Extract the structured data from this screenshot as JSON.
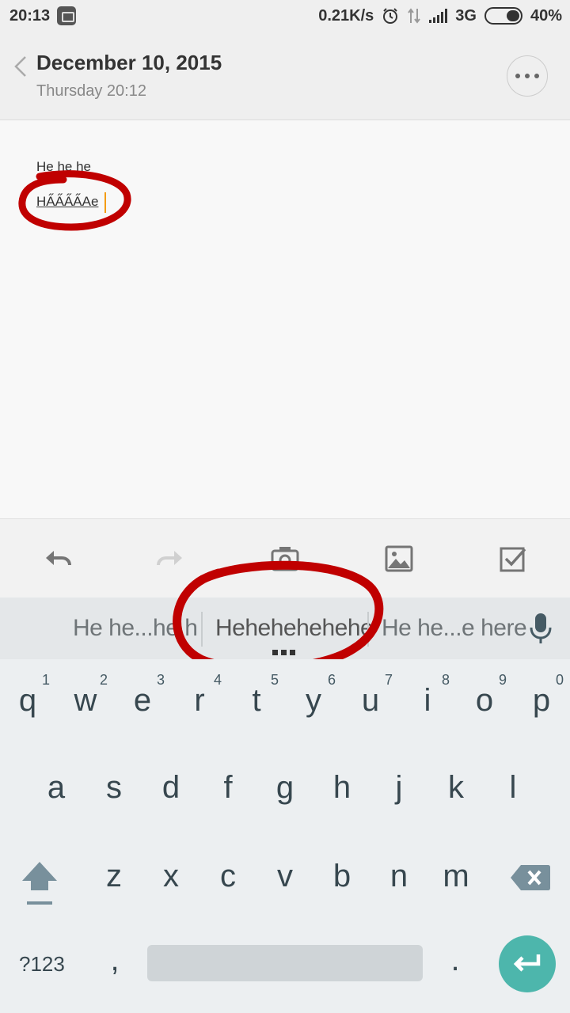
{
  "status_bar": {
    "time": "20:13",
    "net_speed": "0.21K/s",
    "network": "3G",
    "battery": "40%"
  },
  "header": {
    "title": "December 10, 2015",
    "subtitle": "Thursday 20:12"
  },
  "note": {
    "line1": "He he he",
    "line2": "HA̋A̋A̋A̋Ae"
  },
  "toolbar": {
    "icons": [
      "undo-icon",
      "redo-icon",
      "camera-icon",
      "image-icon",
      "checkbox-icon"
    ]
  },
  "suggestions": {
    "left": "He he...he h",
    "middle": "Hehehehehehe",
    "right": "He he...e here"
  },
  "keyboard": {
    "row1": [
      "q",
      "w",
      "e",
      "r",
      "t",
      "y",
      "u",
      "i",
      "o",
      "p"
    ],
    "row1_hints": [
      "1",
      "2",
      "3",
      "4",
      "5",
      "6",
      "7",
      "8",
      "9",
      "0"
    ],
    "row2": [
      "a",
      "s",
      "d",
      "f",
      "g",
      "h",
      "j",
      "k",
      "l"
    ],
    "row3": [
      "z",
      "x",
      "c",
      "v",
      "b",
      "n",
      "m"
    ],
    "symbols_label": "?123",
    "comma": ",",
    "period": "."
  },
  "colors": {
    "accent": "#4db6ac",
    "annotation": "#c00000"
  }
}
